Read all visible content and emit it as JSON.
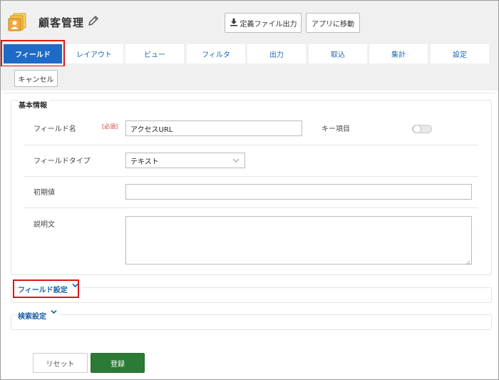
{
  "header": {
    "title": "顧客管理",
    "app_icon": "contacts-folder-icon",
    "edit_icon": "pencil-icon",
    "export_label": "定義ファイル出力",
    "export_icon": "download-icon",
    "move_label": "アプリに移動"
  },
  "tabs": [
    {
      "label": "フィールド",
      "active": true
    },
    {
      "label": "レイアウト"
    },
    {
      "label": "ビュー"
    },
    {
      "label": "フィルタ"
    },
    {
      "label": "出力"
    },
    {
      "label": "取込"
    },
    {
      "label": "集計"
    },
    {
      "label": "設定"
    }
  ],
  "cancel_label": "キャンセル",
  "basic": {
    "section_title": "基本情報",
    "field_name_label": "フィールド名",
    "required_badge": "[必須]",
    "field_name_value": "アクセスURL",
    "key_item_label": "キー項目",
    "key_item_on": false,
    "field_type_label": "フィールドタイプ",
    "field_type_value": "テキスト",
    "initial_value_label": "初期値",
    "initial_value": "",
    "description_label": "説明文",
    "description": ""
  },
  "field_settings_label": "フィールド設定",
  "search_settings_label": "検索設定",
  "footer": {
    "reset_label": "リセット",
    "register_label": "登録"
  },
  "colors": {
    "active_tab": "#1d6bc7",
    "tab_text": "#1a67b3",
    "register_button": "#2b7a35",
    "highlight": "#e01616",
    "required": "#d23b3b"
  }
}
